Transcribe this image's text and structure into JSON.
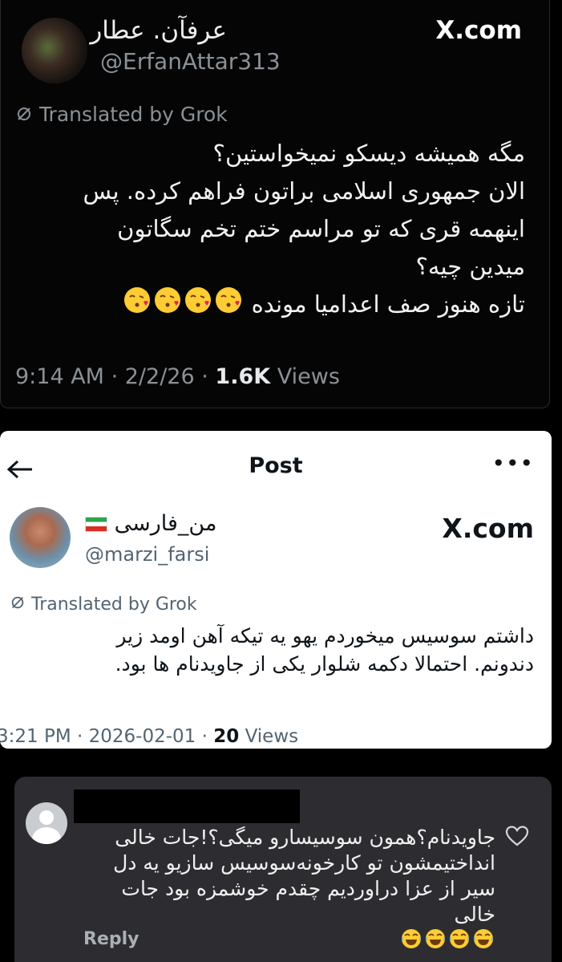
{
  "tweet1": {
    "display_name": "عرفآن. عطار",
    "handle": "@ErfanAttar313",
    "brand": "X.com",
    "translated": "Translated by Grok",
    "lines": [
      "مگه همیشه دیسکو نمیخواستین؟",
      "الان جمهوری اسلامی براتون فراهم کرده. پس",
      "اینهمه قری که تو مراسم ختم تخم سگاتون",
      "میدین چیه؟",
      "تازه هنوز صف اعدامیا مونده"
    ],
    "time": "9:14 AM",
    "date": "2/2/26",
    "views_count": "1.6K",
    "views_label": "Views",
    "emoji": "face-blowing-kiss"
  },
  "tweet2": {
    "header_title": "Post",
    "display_name": "من_فارسی",
    "handle": "@marzi_farsi",
    "brand": "X.com",
    "translated": "Translated by Grok",
    "lines": [
      "داشتم سوسیس میخوردم یهو یه تیکه آهن اومد زیر",
      "دندونم. احتمالا دکمه شلوار یکی از جاویدنام ها بود."
    ],
    "time": "3:21 PM",
    "date": "2026-02-01",
    "views_count": "20",
    "views_label": "Views"
  },
  "comment": {
    "lines": [
      "جاویدنام؟همون سوسیسارو میگی؟!جات خالی",
      "انداختیمشون تو کارخونه‌سوسیس سازیو یه دل",
      "سیر از عزا دراوردیم چقدم خوشمزه بود جات خالی"
    ],
    "reply": "Reply",
    "emoji": "face-with-tears-of-joy"
  }
}
